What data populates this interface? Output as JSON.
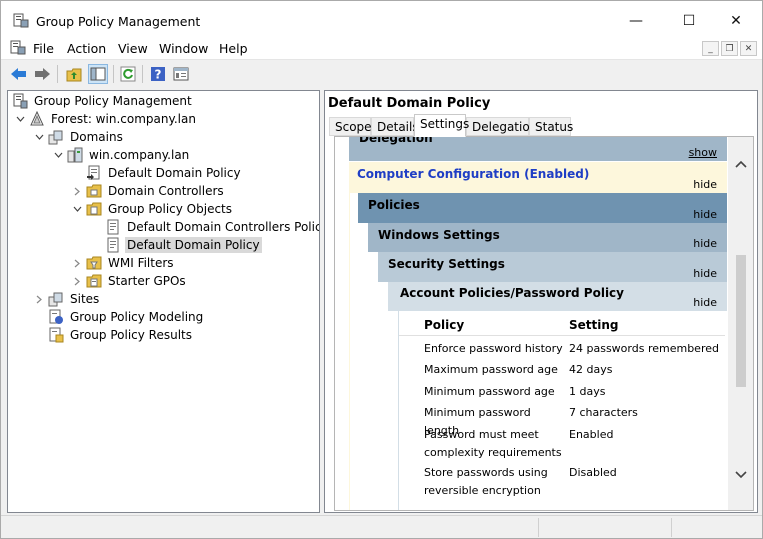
{
  "window": {
    "title": "Group Policy Management",
    "controls": {
      "minimize": "—",
      "maximize": "☐",
      "close": "✕"
    }
  },
  "menu": {
    "items": [
      "File",
      "Action",
      "View",
      "Window",
      "Help"
    ],
    "mdi": {
      "minimize": "_",
      "restore": "❐",
      "close": "✕"
    }
  },
  "tree": {
    "items": [
      {
        "label": "Group Policy Management"
      },
      {
        "label": "Forest: win.company.lan"
      },
      {
        "label": "Domains"
      },
      {
        "label": "win.company.lan"
      },
      {
        "label": "Default Domain Policy"
      },
      {
        "label": "Domain Controllers"
      },
      {
        "label": "Group Policy Objects"
      },
      {
        "label": "Default Domain Controllers Policy"
      },
      {
        "label": "Default Domain Policy"
      },
      {
        "label": "WMI Filters"
      },
      {
        "label": "Starter GPOs"
      },
      {
        "label": "Sites"
      },
      {
        "label": "Group Policy Modeling"
      },
      {
        "label": "Group Policy Results"
      }
    ]
  },
  "details": {
    "title": "Default Domain Policy",
    "tabs": [
      "Scope",
      "Details",
      "Settings",
      "Delegation",
      "Status"
    ],
    "active_tab": "Settings",
    "bands": {
      "delegation": {
        "header": "Delegation",
        "toggle": "show"
      },
      "computer": {
        "header": "Computer Configuration (Enabled)",
        "toggle": "hide"
      },
      "policies": {
        "header": "Policies",
        "toggle": "hide"
      },
      "windows": {
        "header": "Windows Settings",
        "toggle": "hide"
      },
      "security": {
        "header": "Security Settings",
        "toggle": "hide"
      },
      "account": {
        "header": "Account Policies/Password Policy",
        "toggle": "hide"
      }
    },
    "policy_table": {
      "headers": {
        "policy": "Policy",
        "setting": "Setting"
      },
      "rows": [
        {
          "policy": "Enforce password history",
          "setting": "24 passwords remembered"
        },
        {
          "policy": "Maximum password age",
          "setting": "42 days"
        },
        {
          "policy": "Minimum password age",
          "setting": "1 days"
        },
        {
          "policy": "Minimum password length",
          "setting": "7 characters"
        },
        {
          "policy": "Password must meet complexity requirements",
          "setting": "Enabled"
        },
        {
          "policy": "Store passwords using reversible encryption",
          "setting": "Disabled"
        }
      ]
    }
  },
  "colors": {
    "computer_band": "#fdf7dc",
    "policies_band": "#6f93b0",
    "windows_band": "#a0b6c8",
    "security_band": "#b9cad7",
    "account_band": "#d3dee6",
    "delegation_band": "#a0b6c8",
    "link_blue": "#1f3ec5"
  }
}
